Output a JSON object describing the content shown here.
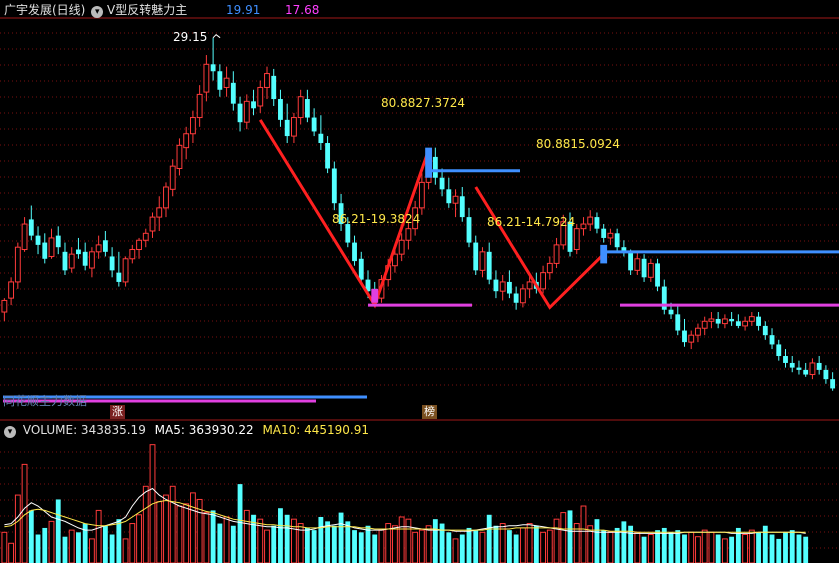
{
  "header": {
    "title": "广宇发展(日线)",
    "indicator_name": "V型反转魅力主",
    "value1": "19.91",
    "value2": "17.68",
    "value1_color": "#3f8fff",
    "value2_color": "#ff3fff",
    "collapse_icon": "chevron-down-icon"
  },
  "price_panel": {
    "peak_label": "29.15",
    "annotations": [
      {
        "text": "80.8827.3724",
        "color": "#ffe84a"
      },
      {
        "text": "86.21-19.3824",
        "color": "#ffe84a"
      },
      {
        "text": "80.8815.0924",
        "color": "#ffe84a"
      },
      {
        "text": "86.21-14.7924",
        "color": "#ffe84a"
      }
    ],
    "footer_text": "同花顺主力数据",
    "badge_zhang": "涨",
    "badge_bang": "榜"
  },
  "volume_panel": {
    "collapse_icon": "chevron-down-icon",
    "volume_label": "VOLUME: 343835.19",
    "ma5_label": "MA5: 363930.22",
    "ma10_label": "MA10: 445190.91",
    "ma5_color": "#ffffff",
    "ma10_color": "#ffe84a"
  },
  "colors": {
    "up": "#ff3b3b",
    "down": "#54ffff",
    "v_line": "#ff2020",
    "resistance": "#3f8fff",
    "support": "#e040e0",
    "grid": "#7a1010",
    "divider": "#a01818"
  },
  "chart_data": {
    "type": "candlestick",
    "title": "广宇发展(日线)",
    "ylim": [
      13.5,
      30.0
    ],
    "v_patterns": [
      {
        "left_high": 25.6,
        "bottom": 17.6,
        "right_high": 24.3
      },
      {
        "left_high": 22.7,
        "bottom": 17.5,
        "right_high": 19.8
      }
    ],
    "resistance_levels": [
      23.4,
      19.9
    ],
    "support_level": 17.6,
    "candles": [
      {
        "o": 17.3,
        "h": 17.9,
        "l": 16.9,
        "c": 17.8
      },
      {
        "o": 17.9,
        "h": 18.8,
        "l": 17.6,
        "c": 18.6
      },
      {
        "o": 18.6,
        "h": 20.3,
        "l": 18.3,
        "c": 20.1
      },
      {
        "o": 20.0,
        "h": 21.4,
        "l": 19.9,
        "c": 21.1
      },
      {
        "o": 21.3,
        "h": 21.9,
        "l": 20.4,
        "c": 20.6
      },
      {
        "o": 20.6,
        "h": 21.0,
        "l": 19.8,
        "c": 20.2
      },
      {
        "o": 20.3,
        "h": 20.7,
        "l": 19.4,
        "c": 19.6
      },
      {
        "o": 19.7,
        "h": 20.9,
        "l": 19.6,
        "c": 20.5
      },
      {
        "o": 20.6,
        "h": 21.0,
        "l": 19.8,
        "c": 20.1
      },
      {
        "o": 19.9,
        "h": 20.3,
        "l": 18.9,
        "c": 19.1
      },
      {
        "o": 19.2,
        "h": 20.1,
        "l": 19.0,
        "c": 19.8
      },
      {
        "o": 20.0,
        "h": 20.5,
        "l": 19.6,
        "c": 19.8
      },
      {
        "o": 19.9,
        "h": 20.3,
        "l": 19.1,
        "c": 19.3
      },
      {
        "o": 19.2,
        "h": 20.1,
        "l": 18.8,
        "c": 19.9
      },
      {
        "o": 19.9,
        "h": 20.6,
        "l": 19.6,
        "c": 20.2
      },
      {
        "o": 20.4,
        "h": 20.8,
        "l": 19.7,
        "c": 19.9
      },
      {
        "o": 19.7,
        "h": 20.1,
        "l": 18.8,
        "c": 19.1
      },
      {
        "o": 19.0,
        "h": 19.9,
        "l": 18.4,
        "c": 18.6
      },
      {
        "o": 18.6,
        "h": 19.7,
        "l": 18.4,
        "c": 19.6
      },
      {
        "o": 19.6,
        "h": 20.2,
        "l": 19.4,
        "c": 20.0
      },
      {
        "o": 20.0,
        "h": 20.5,
        "l": 19.6,
        "c": 20.4
      },
      {
        "o": 20.4,
        "h": 20.9,
        "l": 20.1,
        "c": 20.7
      },
      {
        "o": 20.8,
        "h": 21.6,
        "l": 20.5,
        "c": 21.4
      },
      {
        "o": 21.4,
        "h": 22.3,
        "l": 20.8,
        "c": 21.8
      },
      {
        "o": 21.8,
        "h": 22.9,
        "l": 21.4,
        "c": 22.7
      },
      {
        "o": 22.6,
        "h": 23.9,
        "l": 22.3,
        "c": 23.6
      },
      {
        "o": 23.5,
        "h": 24.8,
        "l": 23.2,
        "c": 24.5
      },
      {
        "o": 24.4,
        "h": 25.3,
        "l": 23.9,
        "c": 25.0
      },
      {
        "o": 25.0,
        "h": 26.0,
        "l": 24.6,
        "c": 25.7
      },
      {
        "o": 25.7,
        "h": 27.1,
        "l": 25.3,
        "c": 26.7
      },
      {
        "o": 26.8,
        "h": 28.4,
        "l": 26.4,
        "c": 28.0
      },
      {
        "o": 28.0,
        "h": 29.15,
        "l": 27.3,
        "c": 27.7
      },
      {
        "o": 27.7,
        "h": 28.0,
        "l": 26.6,
        "c": 26.9
      },
      {
        "o": 27.0,
        "h": 27.9,
        "l": 26.6,
        "c": 27.4
      },
      {
        "o": 27.2,
        "h": 27.7,
        "l": 26.0,
        "c": 26.3
      },
      {
        "o": 26.3,
        "h": 26.6,
        "l": 25.1,
        "c": 25.5
      },
      {
        "o": 25.5,
        "h": 26.7,
        "l": 25.2,
        "c": 26.4
      },
      {
        "o": 26.4,
        "h": 26.9,
        "l": 25.8,
        "c": 26.1
      },
      {
        "o": 26.2,
        "h": 27.3,
        "l": 25.9,
        "c": 27.0
      },
      {
        "o": 27.0,
        "h": 27.9,
        "l": 26.5,
        "c": 27.6
      },
      {
        "o": 27.5,
        "h": 27.8,
        "l": 26.2,
        "c": 26.5
      },
      {
        "o": 26.5,
        "h": 26.9,
        "l": 25.3,
        "c": 25.6
      },
      {
        "o": 25.6,
        "h": 26.3,
        "l": 24.6,
        "c": 24.9
      },
      {
        "o": 24.9,
        "h": 25.9,
        "l": 24.6,
        "c": 25.7
      },
      {
        "o": 25.7,
        "h": 26.9,
        "l": 25.4,
        "c": 26.6
      },
      {
        "o": 26.5,
        "h": 26.9,
        "l": 25.5,
        "c": 25.7
      },
      {
        "o": 25.7,
        "h": 26.1,
        "l": 24.9,
        "c": 25.1
      },
      {
        "o": 25.0,
        "h": 25.8,
        "l": 24.3,
        "c": 24.6
      },
      {
        "o": 24.6,
        "h": 24.9,
        "l": 23.3,
        "c": 23.5
      },
      {
        "o": 23.5,
        "h": 23.8,
        "l": 21.7,
        "c": 22.0
      },
      {
        "o": 22.0,
        "h": 22.4,
        "l": 20.8,
        "c": 21.1
      },
      {
        "o": 21.1,
        "h": 21.4,
        "l": 20.1,
        "c": 20.3
      },
      {
        "o": 20.3,
        "h": 20.6,
        "l": 19.3,
        "c": 19.5
      },
      {
        "o": 19.6,
        "h": 19.9,
        "l": 18.5,
        "c": 18.7
      },
      {
        "o": 18.7,
        "h": 19.1,
        "l": 17.9,
        "c": 18.2
      },
      {
        "o": 18.3,
        "h": 18.6,
        "l": 17.6,
        "c": 17.9
      },
      {
        "o": 17.9,
        "h": 18.9,
        "l": 17.7,
        "c": 18.7
      },
      {
        "o": 18.7,
        "h": 19.6,
        "l": 18.4,
        "c": 19.3
      },
      {
        "o": 19.3,
        "h": 20.1,
        "l": 19.0,
        "c": 19.8
      },
      {
        "o": 19.8,
        "h": 20.7,
        "l": 19.5,
        "c": 20.4
      },
      {
        "o": 20.4,
        "h": 21.2,
        "l": 20.0,
        "c": 20.9
      },
      {
        "o": 20.9,
        "h": 22.1,
        "l": 20.6,
        "c": 21.8
      },
      {
        "o": 21.8,
        "h": 23.3,
        "l": 21.5,
        "c": 22.9
      },
      {
        "o": 22.9,
        "h": 24.3,
        "l": 22.6,
        "c": 24.0
      },
      {
        "o": 24.0,
        "h": 24.4,
        "l": 22.8,
        "c": 23.1
      },
      {
        "o": 23.1,
        "h": 23.5,
        "l": 22.3,
        "c": 22.6
      },
      {
        "o": 22.6,
        "h": 23.1,
        "l": 21.8,
        "c": 22.0
      },
      {
        "o": 22.0,
        "h": 22.6,
        "l": 21.4,
        "c": 22.3
      },
      {
        "o": 22.3,
        "h": 22.7,
        "l": 21.2,
        "c": 21.4
      },
      {
        "o": 21.4,
        "h": 21.8,
        "l": 20.1,
        "c": 20.3
      },
      {
        "o": 20.3,
        "h": 20.6,
        "l": 18.9,
        "c": 19.1
      },
      {
        "o": 19.1,
        "h": 20.1,
        "l": 18.8,
        "c": 19.9
      },
      {
        "o": 19.9,
        "h": 20.3,
        "l": 18.5,
        "c": 18.7
      },
      {
        "o": 18.7,
        "h": 19.1,
        "l": 17.9,
        "c": 18.2
      },
      {
        "o": 18.2,
        "h": 18.9,
        "l": 17.8,
        "c": 18.6
      },
      {
        "o": 18.6,
        "h": 19.1,
        "l": 17.9,
        "c": 18.1
      },
      {
        "o": 18.1,
        "h": 18.4,
        "l": 17.4,
        "c": 17.7
      },
      {
        "o": 17.7,
        "h": 18.5,
        "l": 17.5,
        "c": 18.3
      },
      {
        "o": 18.3,
        "h": 18.9,
        "l": 17.9,
        "c": 18.6
      },
      {
        "o": 18.6,
        "h": 19.0,
        "l": 18.1,
        "c": 18.3
      },
      {
        "o": 18.3,
        "h": 19.3,
        "l": 18.1,
        "c": 19.0
      },
      {
        "o": 19.0,
        "h": 19.7,
        "l": 18.7,
        "c": 19.4
      },
      {
        "o": 19.4,
        "h": 20.5,
        "l": 19.2,
        "c": 20.2
      },
      {
        "o": 20.2,
        "h": 21.5,
        "l": 20.0,
        "c": 21.2
      },
      {
        "o": 21.2,
        "h": 21.6,
        "l": 19.7,
        "c": 19.9
      },
      {
        "o": 20.0,
        "h": 21.1,
        "l": 19.8,
        "c": 20.9
      },
      {
        "o": 20.9,
        "h": 21.4,
        "l": 20.6,
        "c": 21.1
      },
      {
        "o": 21.1,
        "h": 21.7,
        "l": 20.8,
        "c": 21.4
      },
      {
        "o": 21.4,
        "h": 21.6,
        "l": 20.7,
        "c": 20.9
      },
      {
        "o": 20.9,
        "h": 21.1,
        "l": 20.3,
        "c": 20.5
      },
      {
        "o": 20.5,
        "h": 20.9,
        "l": 20.2,
        "c": 20.7
      },
      {
        "o": 20.7,
        "h": 20.9,
        "l": 19.9,
        "c": 20.1
      },
      {
        "o": 20.1,
        "h": 20.4,
        "l": 19.7,
        "c": 19.9
      },
      {
        "o": 19.9,
        "h": 20.0,
        "l": 18.9,
        "c": 19.1
      },
      {
        "o": 19.1,
        "h": 19.9,
        "l": 18.9,
        "c": 19.6
      },
      {
        "o": 19.6,
        "h": 19.8,
        "l": 18.6,
        "c": 18.8
      },
      {
        "o": 18.8,
        "h": 19.6,
        "l": 18.6,
        "c": 19.4
      },
      {
        "o": 19.4,
        "h": 19.6,
        "l": 18.2,
        "c": 18.4
      },
      {
        "o": 18.4,
        "h": 18.7,
        "l": 17.2,
        "c": 17.4
      },
      {
        "o": 17.4,
        "h": 17.7,
        "l": 17.0,
        "c": 17.2
      },
      {
        "o": 17.2,
        "h": 17.6,
        "l": 16.3,
        "c": 16.5
      },
      {
        "o": 16.5,
        "h": 17.0,
        "l": 15.8,
        "c": 16.0
      },
      {
        "o": 16.0,
        "h": 16.5,
        "l": 15.7,
        "c": 16.3
      },
      {
        "o": 16.3,
        "h": 16.8,
        "l": 16.0,
        "c": 16.6
      },
      {
        "o": 16.6,
        "h": 17.1,
        "l": 16.3,
        "c": 16.9
      },
      {
        "o": 16.9,
        "h": 17.3,
        "l": 16.6,
        "c": 17.0
      },
      {
        "o": 17.0,
        "h": 17.3,
        "l": 16.6,
        "c": 16.8
      },
      {
        "o": 16.8,
        "h": 17.2,
        "l": 16.6,
        "c": 17.0
      },
      {
        "o": 17.0,
        "h": 17.3,
        "l": 16.7,
        "c": 16.9
      },
      {
        "o": 16.9,
        "h": 17.2,
        "l": 16.6,
        "c": 16.7
      },
      {
        "o": 16.7,
        "h": 17.1,
        "l": 16.5,
        "c": 16.9
      },
      {
        "o": 16.9,
        "h": 17.3,
        "l": 16.7,
        "c": 17.1
      },
      {
        "o": 17.1,
        "h": 17.3,
        "l": 16.5,
        "c": 16.7
      },
      {
        "o": 16.7,
        "h": 16.9,
        "l": 16.1,
        "c": 16.3
      },
      {
        "o": 16.3,
        "h": 16.6,
        "l": 15.7,
        "c": 15.9
      },
      {
        "o": 15.9,
        "h": 16.1,
        "l": 15.2,
        "c": 15.4
      },
      {
        "o": 15.4,
        "h": 15.7,
        "l": 14.9,
        "c": 15.1
      },
      {
        "o": 15.1,
        "h": 15.4,
        "l": 14.7,
        "c": 14.9
      },
      {
        "o": 14.9,
        "h": 15.2,
        "l": 14.6,
        "c": 14.8
      },
      {
        "o": 14.8,
        "h": 15.1,
        "l": 14.5,
        "c": 14.6
      },
      {
        "o": 14.6,
        "h": 15.3,
        "l": 14.4,
        "c": 15.1
      },
      {
        "o": 15.1,
        "h": 15.4,
        "l": 14.6,
        "c": 14.8
      },
      {
        "o": 14.8,
        "h": 15.0,
        "l": 14.2,
        "c": 14.4
      },
      {
        "o": 14.4,
        "h": 14.7,
        "l": 13.9,
        "c": 14.0
      }
    ],
    "volume": [
      28,
      18,
      62,
      90,
      48,
      26,
      32,
      38,
      58,
      24,
      30,
      28,
      36,
      22,
      48,
      34,
      26,
      40,
      22,
      36,
      44,
      70,
      108,
      56,
      62,
      70,
      52,
      54,
      64,
      58,
      46,
      48,
      36,
      42,
      34,
      72,
      48,
      44,
      40,
      30,
      34,
      50,
      44,
      40,
      36,
      32,
      30,
      42,
      38,
      34,
      46,
      38,
      30,
      28,
      34,
      26,
      30,
      36,
      34,
      42,
      40,
      28,
      30,
      34,
      40,
      36,
      28,
      22,
      26,
      32,
      30,
      28,
      44,
      34,
      36,
      30,
      26,
      32,
      36,
      34,
      28,
      30,
      40,
      46,
      48,
      36,
      52,
      34,
      40,
      30,
      28,
      32,
      38,
      34,
      28,
      24,
      26,
      30,
      32,
      28,
      30,
      26,
      28,
      24,
      30,
      28,
      26,
      22,
      24,
      32,
      26,
      30,
      28,
      34,
      26,
      22,
      28,
      30,
      26,
      24
    ],
    "ma5": [
      35,
      36,
      42,
      50,
      55,
      52,
      47,
      42,
      40,
      38,
      35,
      32,
      30,
      30,
      32,
      34,
      36,
      38,
      42,
      52,
      60,
      65,
      68,
      62,
      58,
      55,
      52,
      50,
      48,
      46,
      45,
      44,
      42,
      40,
      38,
      37,
      36,
      35,
      34,
      33,
      33,
      32,
      32,
      31,
      30,
      30,
      31,
      33,
      34,
      35,
      36,
      34,
      32,
      31,
      30,
      30,
      30,
      31,
      32,
      33,
      33,
      32,
      31,
      30,
      30,
      30,
      30,
      29,
      29,
      29,
      30,
      31,
      32,
      33,
      33,
      34,
      34,
      35,
      35,
      34,
      33,
      32,
      31,
      30,
      29,
      29,
      29,
      29,
      28,
      28,
      28,
      28,
      28,
      27,
      27,
      27,
      27,
      27,
      27,
      27,
      27,
      28,
      28,
      28,
      28,
      28,
      28,
      28,
      27,
      27,
      27,
      27,
      28,
      28,
      28,
      28,
      28,
      28,
      28,
      27
    ],
    "ma10": [
      33,
      34,
      38,
      44,
      48,
      49,
      48,
      46,
      44,
      42,
      40,
      38,
      36,
      35,
      34,
      34,
      35,
      36,
      38,
      42,
      46,
      50,
      54,
      56,
      57,
      56,
      55,
      53,
      51,
      49,
      47,
      46,
      44,
      42,
      40,
      39,
      38,
      37,
      36,
      35,
      35,
      34,
      34,
      33,
      33,
      32,
      32,
      32,
      33,
      33,
      33,
      33,
      33,
      32,
      32,
      31,
      31,
      31,
      31,
      31,
      31,
      31,
      31,
      31,
      31,
      30,
      30,
      30,
      30,
      30,
      30,
      30,
      31,
      31,
      31,
      31,
      32,
      32,
      32,
      32,
      32,
      32,
      32,
      31,
      31,
      31,
      31,
      30,
      30,
      30,
      29,
      29,
      29,
      29,
      28,
      28,
      28,
      28,
      28,
      28,
      28,
      28,
      28,
      28,
      28,
      28,
      28,
      28,
      28,
      28,
      28,
      28,
      28,
      28,
      28,
      28,
      28,
      28,
      28,
      28
    ],
    "volume_ylim": [
      0,
      115
    ]
  }
}
